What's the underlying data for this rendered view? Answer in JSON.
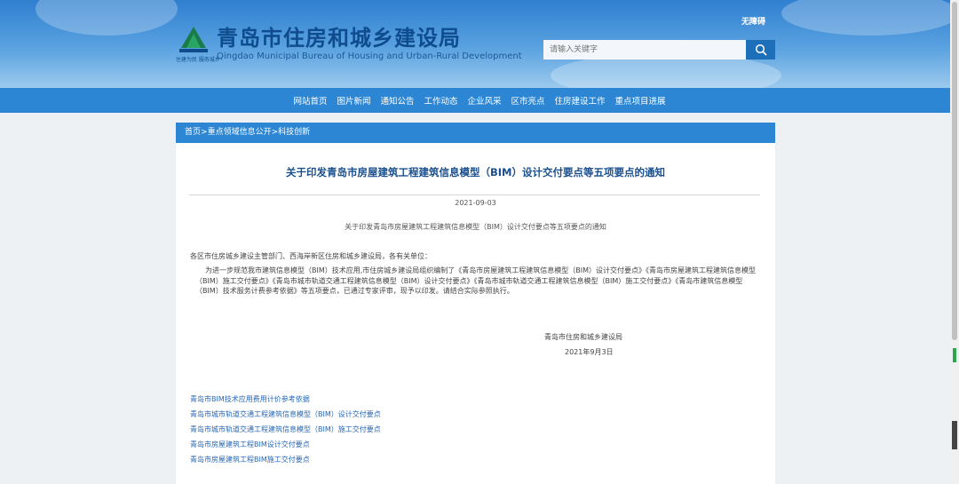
{
  "header": {
    "logo_cn": "青岛市住房和城乡建设局",
    "logo_en": "Qingdao Municipal Bureau of Housing and Urban-Rural Development",
    "logo_sub": "住建为民 服务城乡",
    "accessibility_label": "无障碍",
    "search_placeholder": "请输入关键字",
    "colors": {
      "header_top": "#2f7fd0",
      "nav": "#2c86d3",
      "title": "#1a4f8c",
      "link": "#2767b5"
    }
  },
  "nav": {
    "items": [
      "网站首页",
      "图片新闻",
      "通知公告",
      "工作动态",
      "企业风采",
      "区市亮点",
      "住房建设工作",
      "重点项目进展"
    ]
  },
  "breadcrumb": {
    "home": "首页",
    "level1": "重点领域信息公开",
    "level2": "科技创新",
    "sep": ">"
  },
  "article": {
    "title": "关于印发青岛市房屋建筑工程建筑信息模型（BIM）设计交付要点等五项要点的通知",
    "date": "2021-09-03",
    "subtitle": "关于印发青岛市房屋建筑工程建筑信息模型（BIM）设计交付要点等五项要点的通知",
    "addressee": "各区市住房城乡建设主管部门、西海岸新区住房和城乡建设局，各有关单位：",
    "body": "为进一步规范我市建筑信息模型（BIM）技术应用,市住房城乡建设局组织编制了《青岛市房屋建筑工程建筑信息模型（BIM）设计交付要点》《青岛市房屋建筑工程建筑信息模型（BIM）施工交付要点》《青岛市城市轨道交通工程建筑信息模型（BIM）设计交付要点》《青岛市城市轨道交通工程建筑信息模型（BIM）施工交付要点》《青岛市建筑信息模型（BIM）技术服务计费参考依据》等五项要点，已通过专家评审，现予以印发。请结合实际参照执行。",
    "sign_org": "青岛市住房和城乡建设局",
    "sign_date": "2021年9月3日",
    "attachments": [
      "青岛市BIM技术应用费用计价参考依据",
      "青岛市城市轨道交通工程建筑信息模型（BIM）设计交付要点",
      "青岛市城市轨道交通工程建筑信息模型（BIM）施工交付要点",
      "青岛市房屋建筑工程BIM设计交付要点",
      "青岛市房屋建筑工程BIM施工交付要点"
    ]
  }
}
